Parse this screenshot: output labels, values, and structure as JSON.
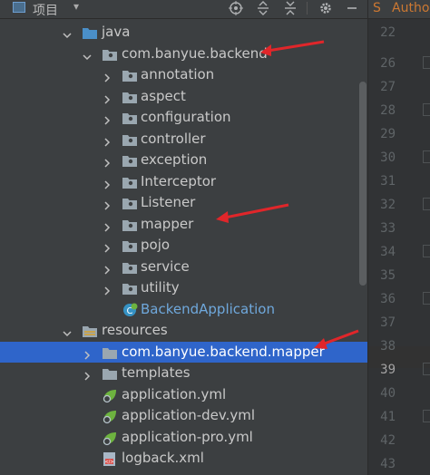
{
  "toolbar": {
    "title": "项目",
    "chevron": "▾",
    "icons": [
      "target-icon",
      "collapse-all-icon",
      "expand-all-icon",
      "gear-icon",
      "minimize-icon"
    ]
  },
  "editor_tab": {
    "label": "Autho"
  },
  "tree": [
    {
      "label": "java",
      "depth": 0,
      "expanded": true,
      "icon": "source-folder-icon"
    },
    {
      "label": "com.banyue.backend",
      "depth": 1,
      "expanded": true,
      "icon": "package-icon"
    },
    {
      "label": "annotation",
      "depth": 2,
      "expanded": false,
      "icon": "package-icon"
    },
    {
      "label": "aspect",
      "depth": 2,
      "expanded": false,
      "icon": "package-icon"
    },
    {
      "label": "configuration",
      "depth": 2,
      "expanded": false,
      "icon": "package-icon"
    },
    {
      "label": "controller",
      "depth": 2,
      "expanded": false,
      "icon": "package-icon"
    },
    {
      "label": "exception",
      "depth": 2,
      "expanded": false,
      "icon": "package-icon"
    },
    {
      "label": "Interceptor",
      "depth": 2,
      "expanded": false,
      "icon": "package-icon"
    },
    {
      "label": "Listener",
      "depth": 2,
      "expanded": false,
      "icon": "package-icon"
    },
    {
      "label": "mapper",
      "depth": 2,
      "expanded": false,
      "icon": "package-icon"
    },
    {
      "label": "pojo",
      "depth": 2,
      "expanded": false,
      "icon": "package-icon"
    },
    {
      "label": "service",
      "depth": 2,
      "expanded": false,
      "icon": "package-icon"
    },
    {
      "label": "utility",
      "depth": 2,
      "expanded": false,
      "icon": "package-icon"
    },
    {
      "label": "BackendApplication",
      "depth": 2,
      "expanded": null,
      "icon": "spring-boot-class-icon"
    },
    {
      "label": "resources",
      "depth": 0,
      "expanded": true,
      "icon": "resources-folder-icon"
    },
    {
      "label": "com.banyue.backend.mapper",
      "depth": 1,
      "expanded": false,
      "icon": "folder-icon",
      "selected": true
    },
    {
      "label": "templates",
      "depth": 1,
      "expanded": false,
      "icon": "folder-icon"
    },
    {
      "label": "application.yml",
      "depth": 1,
      "expanded": null,
      "icon": "spring-config-icon"
    },
    {
      "label": "application-dev.yml",
      "depth": 1,
      "expanded": null,
      "icon": "spring-config-icon"
    },
    {
      "label": "application-pro.yml",
      "depth": 1,
      "expanded": null,
      "icon": "spring-config-icon"
    },
    {
      "label": "logback.xml",
      "depth": 1,
      "expanded": null,
      "icon": "xml-file-icon"
    }
  ],
  "line_numbers": [
    "22",
    "26",
    "27",
    "28",
    "29",
    "30",
    "31",
    "32",
    "33",
    "34",
    "35",
    "36",
    "37",
    "38",
    "39",
    "40",
    "41",
    "42",
    "43"
  ],
  "current_line": "39",
  "colors": {
    "background": "#3c3f41",
    "selection": "#2f65ca",
    "annotation_arrow": "#e0262a",
    "class_label": "#6fa8dc"
  }
}
